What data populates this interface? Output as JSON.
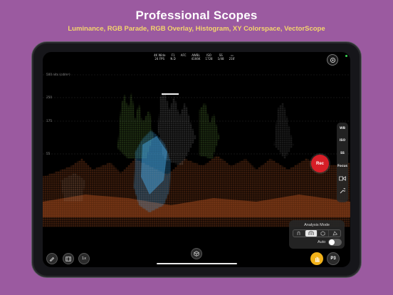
{
  "marketing": {
    "headline": "Professional Scopes",
    "subline": "Luminance, RGB Parade, RGB Overlay, Histogram, XY Colorspace, VectorScope"
  },
  "camera_stats": [
    {
      "top": "4K Wide",
      "bottom": "24 FPS"
    },
    {
      "top": "F1",
      "bottom": "N.D"
    },
    {
      "top": "AFC",
      "bottom": ""
    },
    {
      "top": "AWBL",
      "bottom": "4166K"
    },
    {
      "top": "ISO",
      "bottom": "1728"
    },
    {
      "top": "SS",
      "bottom": "1/48"
    },
    {
      "top": "▭",
      "bottom": "216'"
    }
  ],
  "scope": {
    "axis_title": "500 nits (cd/m²)",
    "ticks": [
      "250",
      "175",
      "55"
    ]
  },
  "right_rail": {
    "wb": "WB",
    "iso": "ISO",
    "ss": "SS",
    "focus": "Focus"
  },
  "record_button": "Rec",
  "analysis_panel": {
    "title": "Analysis Mode",
    "auto_label": "Auto",
    "auto_enabled": false,
    "selected_mode": "parade"
  },
  "bottom_bar": {
    "zoom_label": "1x",
    "gamut_label": "P3"
  },
  "icons": [
    "settings-icon",
    "record-icon",
    "lens-icon",
    "wrench-icon",
    "pen-icon",
    "film-icon",
    "cube-icon",
    "hand-icon"
  ],
  "colors": {
    "background": "#9b5aa0",
    "subline": "#f4d66c",
    "record": "#d61e27",
    "mode_button": "#f2b21a"
  }
}
